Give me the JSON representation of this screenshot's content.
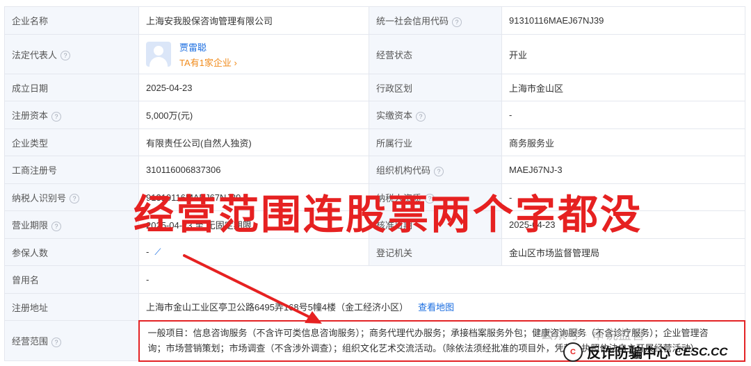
{
  "rows": {
    "company_name": {
      "label": "企业名称",
      "value": "上海安我股保咨询管理有限公司",
      "label2": "统一社会信用代码",
      "value2": "91310116MAEJ67NJ39"
    },
    "legal_rep": {
      "label": "法定代表人",
      "name": "贾雷聪",
      "link": "TA有1家企业 ›",
      "label2": "经营状态",
      "value2": "开业"
    },
    "founded": {
      "label": "成立日期",
      "value": "2025-04-23",
      "label2": "行政区划",
      "value2": "上海市金山区"
    },
    "capital": {
      "label": "注册资本",
      "value": "5,000万(元)",
      "label2": "实缴资本",
      "value2": "-"
    },
    "type": {
      "label": "企业类型",
      "value": "有限责任公司(自然人独资)",
      "label2": "所属行业",
      "value2": "商务服务业"
    },
    "reg_no": {
      "label": "工商注册号",
      "value": "310116006837306",
      "label2": "组织机构代码",
      "value2": "MAEJ67NJ-3"
    },
    "tax_id": {
      "label": "纳税人识别号",
      "value": "91310116MAEJ67NJ39",
      "label2": "纳税人资质",
      "value2": "-"
    },
    "term": {
      "label": "营业期限",
      "value": "2025-04-23 至 无固定期限",
      "label2": "核准日期",
      "value2": "2025-04-23"
    },
    "insured": {
      "label": "参保人数",
      "value": "-",
      "label2": "登记机关",
      "value2": "金山区市场监督管理局"
    },
    "former_name": {
      "label": "曾用名",
      "value": "-"
    },
    "address": {
      "label": "注册地址",
      "value": "上海市金山工业区亭卫公路6495弄168号5幢4楼（金工经济小区）",
      "link": "查看地图"
    },
    "scope": {
      "label": "经营范围",
      "line1": "一般项目：信息咨询服务（不含许可类信息咨询服务）；商务代理代办服务；承接档案服务外包；健康咨询服务（不含诊疗服务）；企业管理咨",
      "line2": "询；市场营销策划；市场调查（不含涉外调查）；组织文化艺术交流活动。（除依法须经批准的项目外，凭营业执照依法自主开展经营活动）"
    }
  },
  "overlay": {
    "banner": "经营范围连股票两个字都没",
    "watermark_top": "公众号 · 审说监管",
    "watermark_brand": "反诈防骗中心",
    "watermark_url": "CESC.CC",
    "watermark_logo": "C"
  },
  "colors": {
    "accent": "#e62121",
    "link": "#1a6de0",
    "orange": "#f08b1c"
  }
}
